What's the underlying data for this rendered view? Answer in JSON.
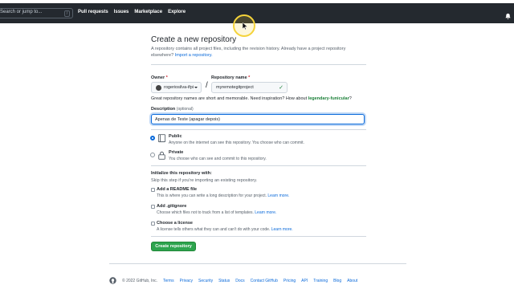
{
  "topbar": {
    "search_placeholder": "Search or jump to...",
    "search_shortcut": "/",
    "nav": [
      "Pull requests",
      "Issues",
      "Marketplace",
      "Explore"
    ]
  },
  "page": {
    "title": "Create a new repository",
    "intro": "A repository contains all project files, including the revision history. Already have a project repository elsewhere?",
    "import_link": "Import a repository."
  },
  "form": {
    "owner_label": "Owner",
    "owner_value": "rogeriosilva-ifpi",
    "required_mark": "*",
    "repo_label": "Repository name",
    "repo_value": "myremotegitproject",
    "separator": "/",
    "hint_prefix": "Great repository names are short and memorable. Need inspiration? How about",
    "hint_suggestion": "legendary-funicular",
    "hint_suffix": "?",
    "description_label": "Description",
    "description_optional": "(optional)",
    "description_value": "Apenas de Teste (apagar depois)"
  },
  "visibility": {
    "public": {
      "title": "Public",
      "desc": "Anyone on the internet can see this repository. You choose who can commit.",
      "selected": true
    },
    "private": {
      "title": "Private",
      "desc": "You choose who can see and commit to this repository.",
      "selected": false
    }
  },
  "init": {
    "title": "Initialize this repository with:",
    "subtitle": "Skip this step if you're importing an existing repository.",
    "options": [
      {
        "title": "Add a README file",
        "desc": "This is where you can write a long description for your project.",
        "link": "Learn more."
      },
      {
        "title": "Add .gitignore",
        "desc": "Choose which files not to track from a list of templates.",
        "link": "Learn more."
      },
      {
        "title": "Choose a license",
        "desc": "A license tells others what they can and can't do with your code.",
        "link": "Learn more."
      }
    ]
  },
  "create_button": "Create repository",
  "footer": {
    "copyright": "© 2022 GitHub, Inc.",
    "links": [
      "Terms",
      "Privacy",
      "Security",
      "Status",
      "Docs",
      "Contact GitHub",
      "Pricing",
      "API",
      "Training",
      "Blog",
      "About"
    ]
  },
  "colors": {
    "topbar": "#24292f",
    "accent": "#0969da",
    "create": "#2da44e",
    "success": "#1a7f37"
  }
}
